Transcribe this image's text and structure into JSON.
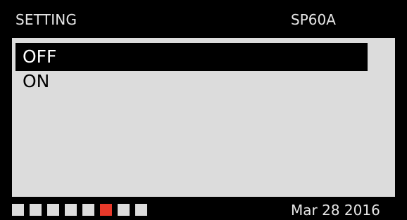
{
  "header": {
    "title": "SETTING",
    "device": "SP60A"
  },
  "options": [
    {
      "label": "OFF",
      "selected": true
    },
    {
      "label": "ON",
      "selected": false
    }
  ],
  "pager": {
    "count": 8,
    "active_index": 5
  },
  "footer": {
    "date": "Mar 28 2016"
  },
  "colors": {
    "background": "#000000",
    "panel": "#dcdcdc",
    "text": "#e6e6e6",
    "selection": "#000000",
    "active_indicator": "#e8392a"
  }
}
